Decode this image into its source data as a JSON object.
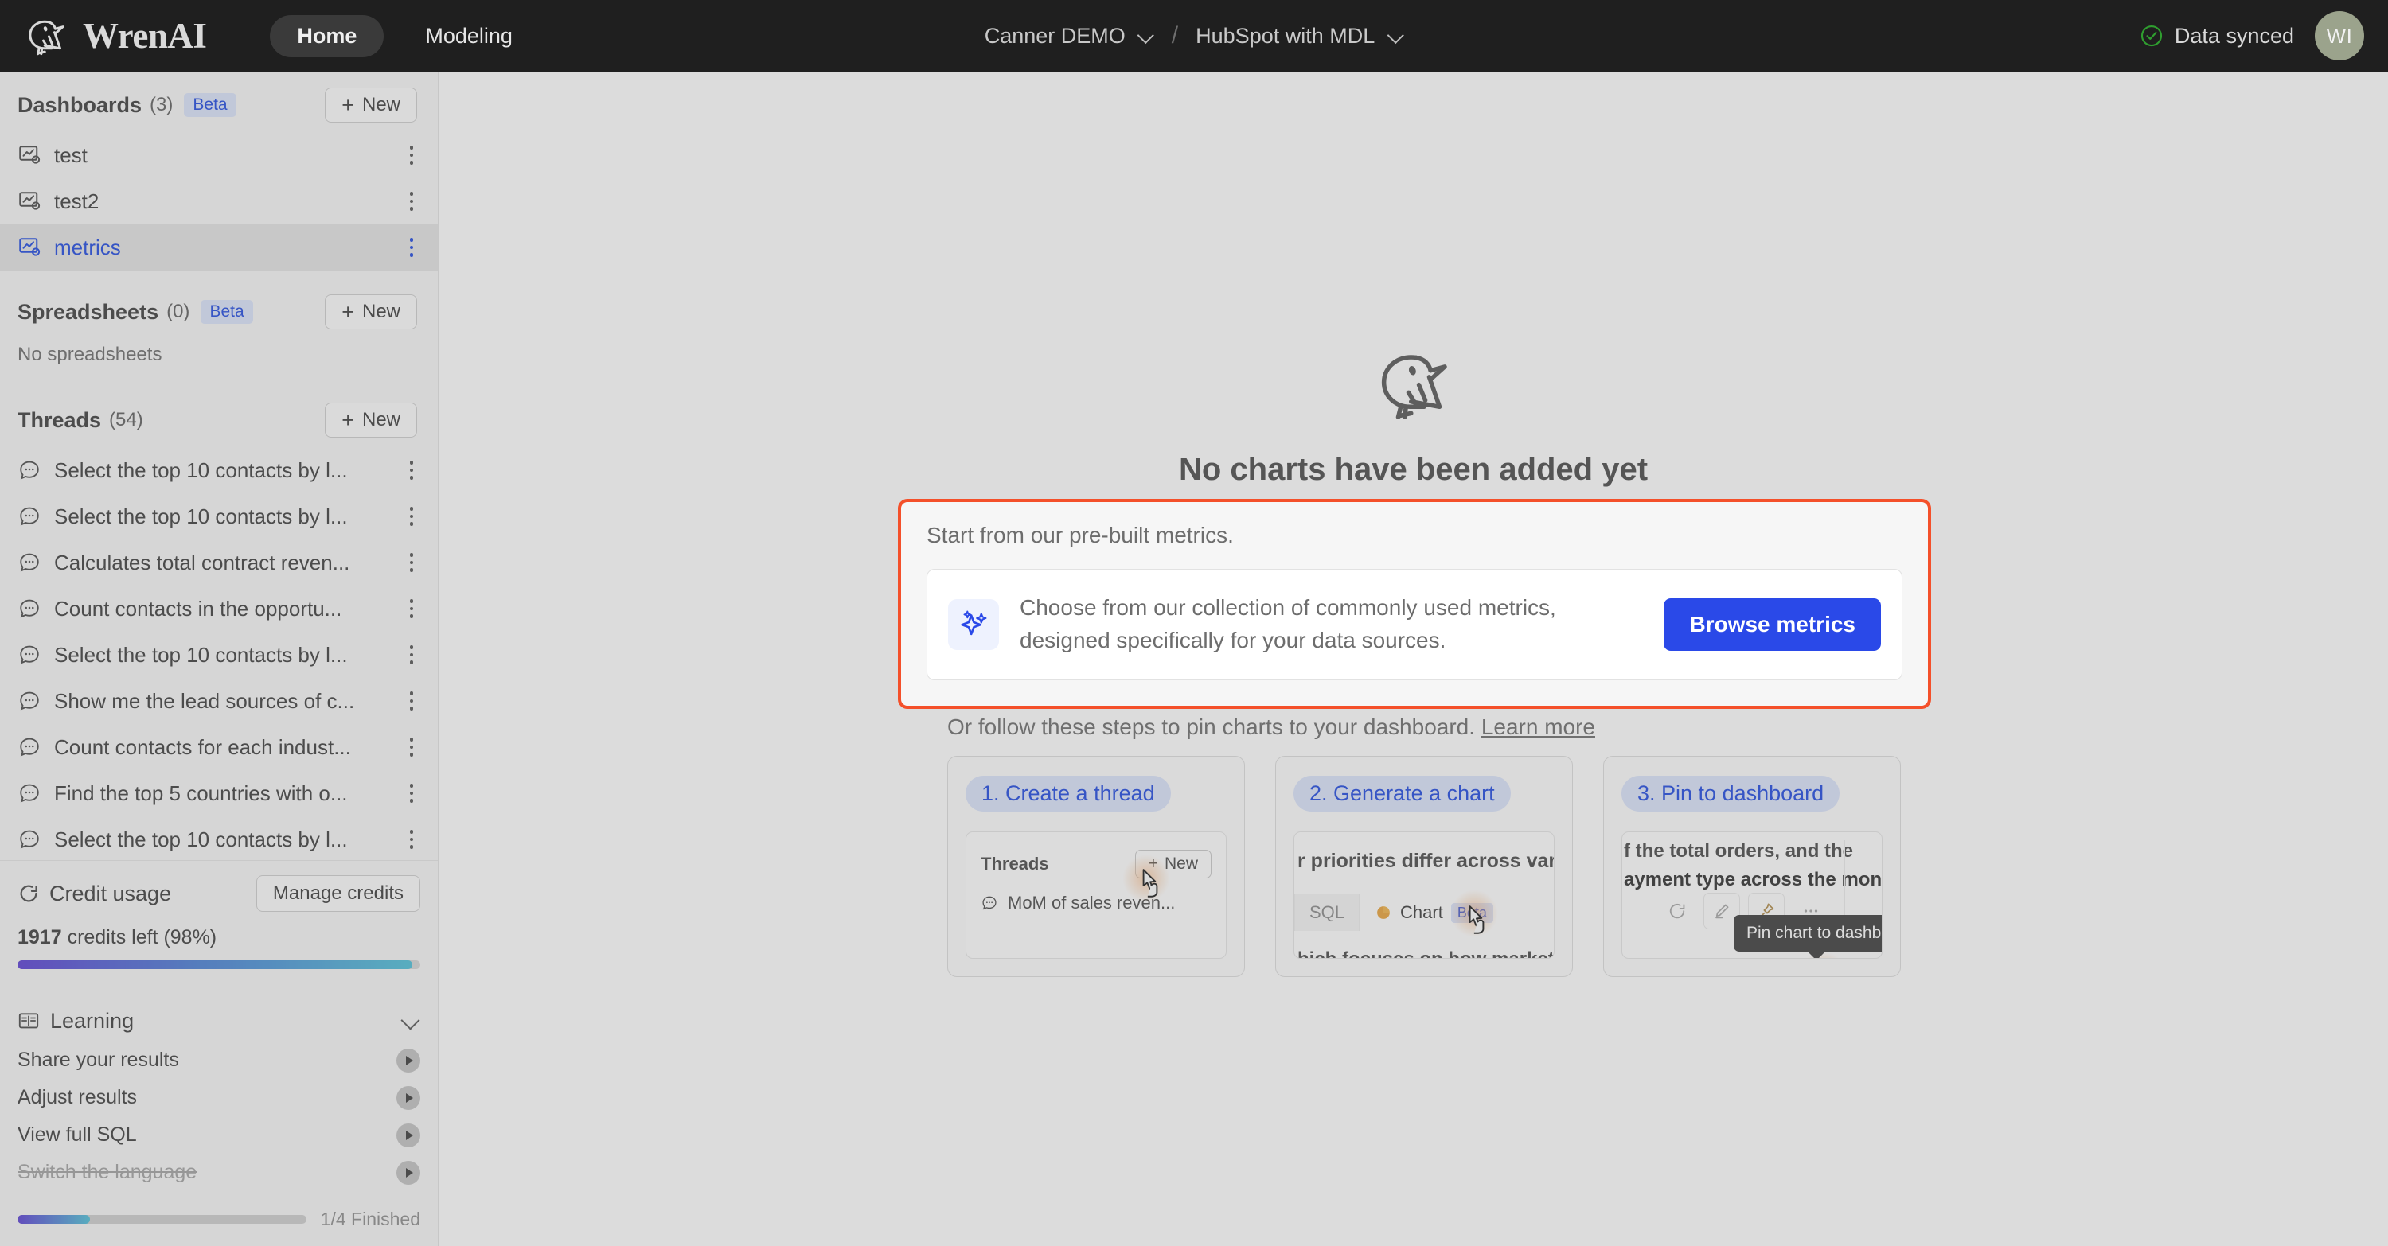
{
  "header": {
    "brand": "WrenAI",
    "nav": [
      {
        "label": "Home",
        "active": true
      },
      {
        "label": "Modeling",
        "active": false
      }
    ],
    "project": "Canner DEMO",
    "separator": "/",
    "model": "HubSpot with MDL",
    "sync_status": "Data synced",
    "avatar_initials": "WI",
    "accent_color": "#2a49e8",
    "sync_color": "#2f9e2f"
  },
  "sidebar": {
    "dashboards": {
      "title": "Dashboards",
      "count": "(3)",
      "beta": "Beta",
      "new_label": "New",
      "items": [
        {
          "label": "test",
          "selected": false
        },
        {
          "label": "test2",
          "selected": false
        },
        {
          "label": "metrics",
          "selected": true
        }
      ]
    },
    "spreadsheets": {
      "title": "Spreadsheets",
      "count": "(0)",
      "beta": "Beta",
      "new_label": "New",
      "empty": "No spreadsheets"
    },
    "threads": {
      "title": "Threads",
      "count": "(54)",
      "new_label": "New",
      "items": [
        {
          "label": "Select the top 10 contacts by l..."
        },
        {
          "label": "Select the top 10 contacts by l..."
        },
        {
          "label": "Calculates total contract reven..."
        },
        {
          "label": "Count contacts in the opportu..."
        },
        {
          "label": "Select the top 10 contacts by l..."
        },
        {
          "label": "Show me the lead sources of c..."
        },
        {
          "label": "Count contacts for each indust..."
        },
        {
          "label": "Find the top 5 countries with o..."
        },
        {
          "label": "Select the top 10 contacts by l..."
        }
      ]
    },
    "credit": {
      "title": "Credit usage",
      "manage_label": "Manage credits",
      "credits_number": "1917",
      "credits_text": " credits left (98%)",
      "percent": 98
    },
    "learning": {
      "title": "Learning",
      "items": [
        {
          "label": "Share your results",
          "done": false
        },
        {
          "label": "Adjust results",
          "done": false
        },
        {
          "label": "View full SQL",
          "done": false
        },
        {
          "label": "Switch the language",
          "done": true
        }
      ],
      "progress_label": "1/4 Finished",
      "progress_percent": 25
    }
  },
  "main": {
    "empty_title": "No charts have been added yet",
    "metrics_panel": {
      "lead": "Start from our pre-built metrics.",
      "card_text_line1": "Choose from our collection of commonly used metrics,",
      "card_text_line2": "designed specifically for your data sources.",
      "button_label": "Browse metrics",
      "highlight_color": "#f4502a"
    },
    "steps_lead": "Or follow these steps to pin charts to your dashboard.",
    "steps_learn_more": "Learn more",
    "steps": [
      {
        "badge": "1. Create a thread",
        "mock": {
          "threads_label": "Threads",
          "new_label": "New",
          "item_label": "MoM of sales reven..."
        }
      },
      {
        "badge": "2. Generate a chart",
        "mock": {
          "headline": "r priorities differ across vario",
          "tab_sql": "SQL",
          "tab_chart": "Chart",
          "tab_chart_beta": "Beta",
          "bottom_line": "hich focuses on how market"
        }
      },
      {
        "badge": "3. Pin to dashboard",
        "mock": {
          "line1": "f the total orders, and the",
          "line2": "ayment type across the months.",
          "tooltip": "Pin chart to dashboard",
          "icons": [
            "refresh-icon",
            "edit-icon",
            "pin-icon",
            "more-icon"
          ]
        }
      }
    ]
  }
}
